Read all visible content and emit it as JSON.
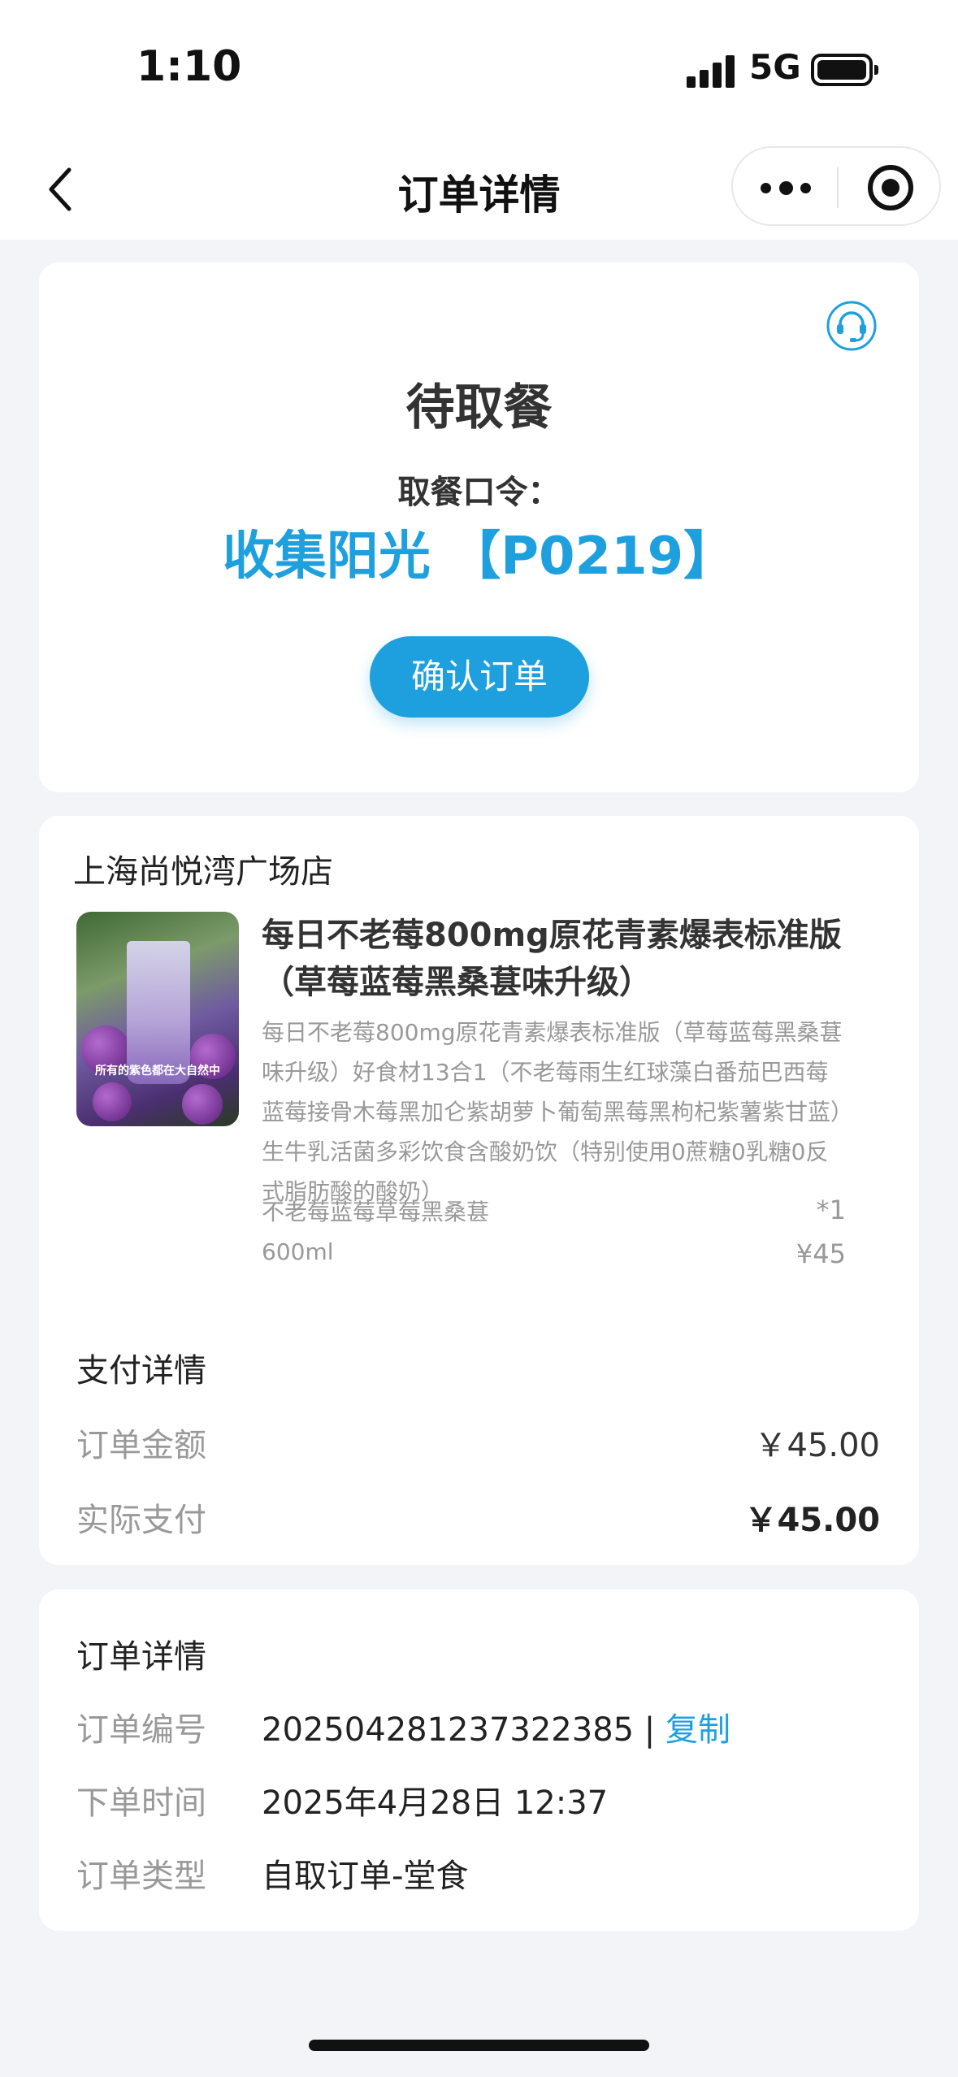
{
  "status_bar": {
    "time": "1:10",
    "network": "5G"
  },
  "nav": {
    "title": "订单详情"
  },
  "pickup": {
    "status": "待取餐",
    "code_label": "取餐口令：",
    "code_value": "收集阳光 【P0219】",
    "confirm_button": "确认订单"
  },
  "store": {
    "name": "上海尚悦湾广场店"
  },
  "product": {
    "name": "每日不老莓800mg原花青素爆表标准版（草莓蓝莓黑桑葚味升级）",
    "description": "每日不老莓800mg原花青素爆表标准版（草莓蓝莓黑桑葚味升级）好食材13合1（不老莓雨生红球藻白番茄巴西莓蓝莓接骨木莓黑加仑紫胡萝卜葡萄黑莓黑枸杞紫薯紫甘蓝）生牛乳活菌多彩饮食含酸奶饮（特别使用0蔗糖0乳糖0反式脂肪酸的酸奶）",
    "spec": "不老莓蓝莓草莓黑桑葚",
    "quantity": "*1",
    "size": "600ml",
    "price": "¥45",
    "image_caption": "所有的紫色都在大自然中"
  },
  "payment": {
    "title": "支付详情",
    "order_amount_label": "订单金额",
    "order_amount_value": "￥45.00",
    "actual_paid_label": "实际支付",
    "actual_paid_value": "￥45.00"
  },
  "order_info": {
    "title": "订单详情",
    "number_label": "订单编号",
    "number_value": "2025042812373223​85",
    "separator": " | ",
    "copy_label": "复制",
    "time_label": "下单时间",
    "time_value": "2025年4月28日 12:37",
    "type_label": "订单类型",
    "type_value": "自取订单-堂食"
  },
  "colors": {
    "accent": "#1ea0de",
    "background": "#f3f4f8",
    "card": "#ffffff",
    "muted_text": "#999999"
  }
}
